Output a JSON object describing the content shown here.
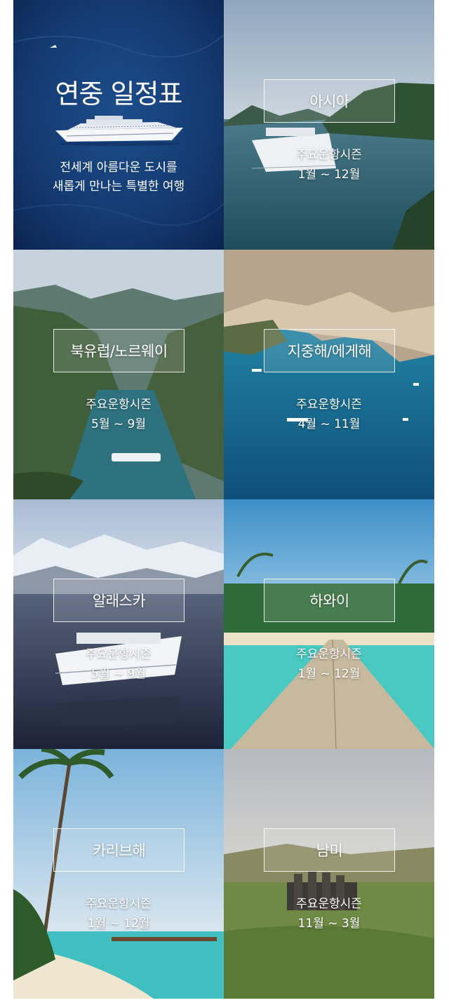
{
  "intro": {
    "title": "연중 일정표",
    "desc_line1": "전세계 아름다운 도시를",
    "desc_line2": "새롭게 만나는 특별한 여행"
  },
  "season_label": "주요운항시즌",
  "regions": [
    {
      "name": "아시아",
      "season": "1월 ~ 12월"
    },
    {
      "name": "북유럽/노르웨이",
      "season": "5월 ~ 9월"
    },
    {
      "name": "지중해/에게해",
      "season": "4월 ~ 11월"
    },
    {
      "name": "알래스카",
      "season": "5월 ~ 9월"
    },
    {
      "name": "하와이",
      "season": "1월 ~ 12월"
    },
    {
      "name": "카리브해",
      "season": "1월 ~ 12월"
    },
    {
      "name": "남미",
      "season": "11월 ~ 3월"
    }
  ]
}
